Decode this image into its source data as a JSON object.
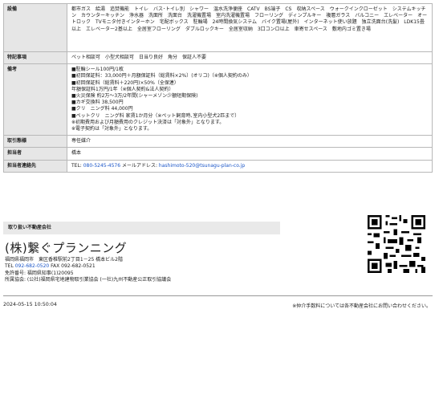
{
  "specs": {
    "equipment": {
      "label": "設備",
      "value": "都市ガス　給湯　追焚機能　トイレ　バス･トイレ別　シャワー　温水洗浄便座　CATV　BS端子　CS　収納スペース　ウォークインクローゼット　システムキッチン　カウンターキッチン　浄水器　洗面所　洗面台　洗濯機置場　室内洗濯機置場　フローリング　ディンプルキー　複層ガラス　バルコニー　エレベーター　オートロック　TVモニタ付きインターホン　宅配ボックス　駐輪場　24時間換気システム　バイク置場(屋外)　インターネット使い放題　独立洗面台(洗髪)　LDK15畳以上　エレベーター2基以上　全居室フローリング　ダブルロックキー　全居室収納　3口コンロ以上　車寄せスペース　敷地内ゴミ置き場"
    },
    "special": {
      "label": "特記事項",
      "value": "ペット相談可　小型犬相談可　日当り良好　角分　保証人不要"
    },
    "remarks": {
      "label": "備考",
      "value": "■駐輪シール100円/1枚\n■初回保証料：33,000円＋月額保証料（総賃料×2%）(オリコ)（※個人契約のみ）\n■初回保証料（総賃料＋220円)×50%（全保連）\n年額保証料1万円/1年（※個人契約&法人契約）\n■火災保険 約2万～3万/2年間(シャーメゾン少額短期保険)\n■カギ交換料 38,500円\n■クリ　ニング料 44,000円\n■ペットクリ　ニング料 家賃1か月分（※ペット飼育時､室内小型犬2匹まで）\n※初期費用および月額費用のクレジット決済は「対象外」となります。\n※電子契約は「対象外」となります。"
    },
    "transaction": {
      "label": "取引態様",
      "value": "専任媒介"
    },
    "staff": {
      "label": "担当者",
      "value": "橋本"
    },
    "contact": {
      "label": "担当者連絡先",
      "prefix": "TEL: ",
      "tel": "080-5245-4576",
      "mail_label": " メールアドレス: ",
      "email": "hashimoto-520@tsunagu-plan-co.jp"
    }
  },
  "company": {
    "section_label": "取り扱い不動産会社",
    "name": "(株)繋ぐプランニング",
    "address": "福岡県福岡市　東区香椎駅前2丁目1－25 橋本ビル2階",
    "tel_label": "TEL ",
    "tel": "092-682-0520",
    "fax": " FAX 092-682-0521",
    "license": "免許番号: 福岡県知事(1)20095",
    "association": "所属協会: (公社)福岡県宅地建物取引業協会 (一社)九州不動産公正取引協議会"
  },
  "footer": {
    "date": "2024-05-15 10:50:04",
    "note": "※仲介手数料については各不動産会社にお問い合わせください。"
  }
}
